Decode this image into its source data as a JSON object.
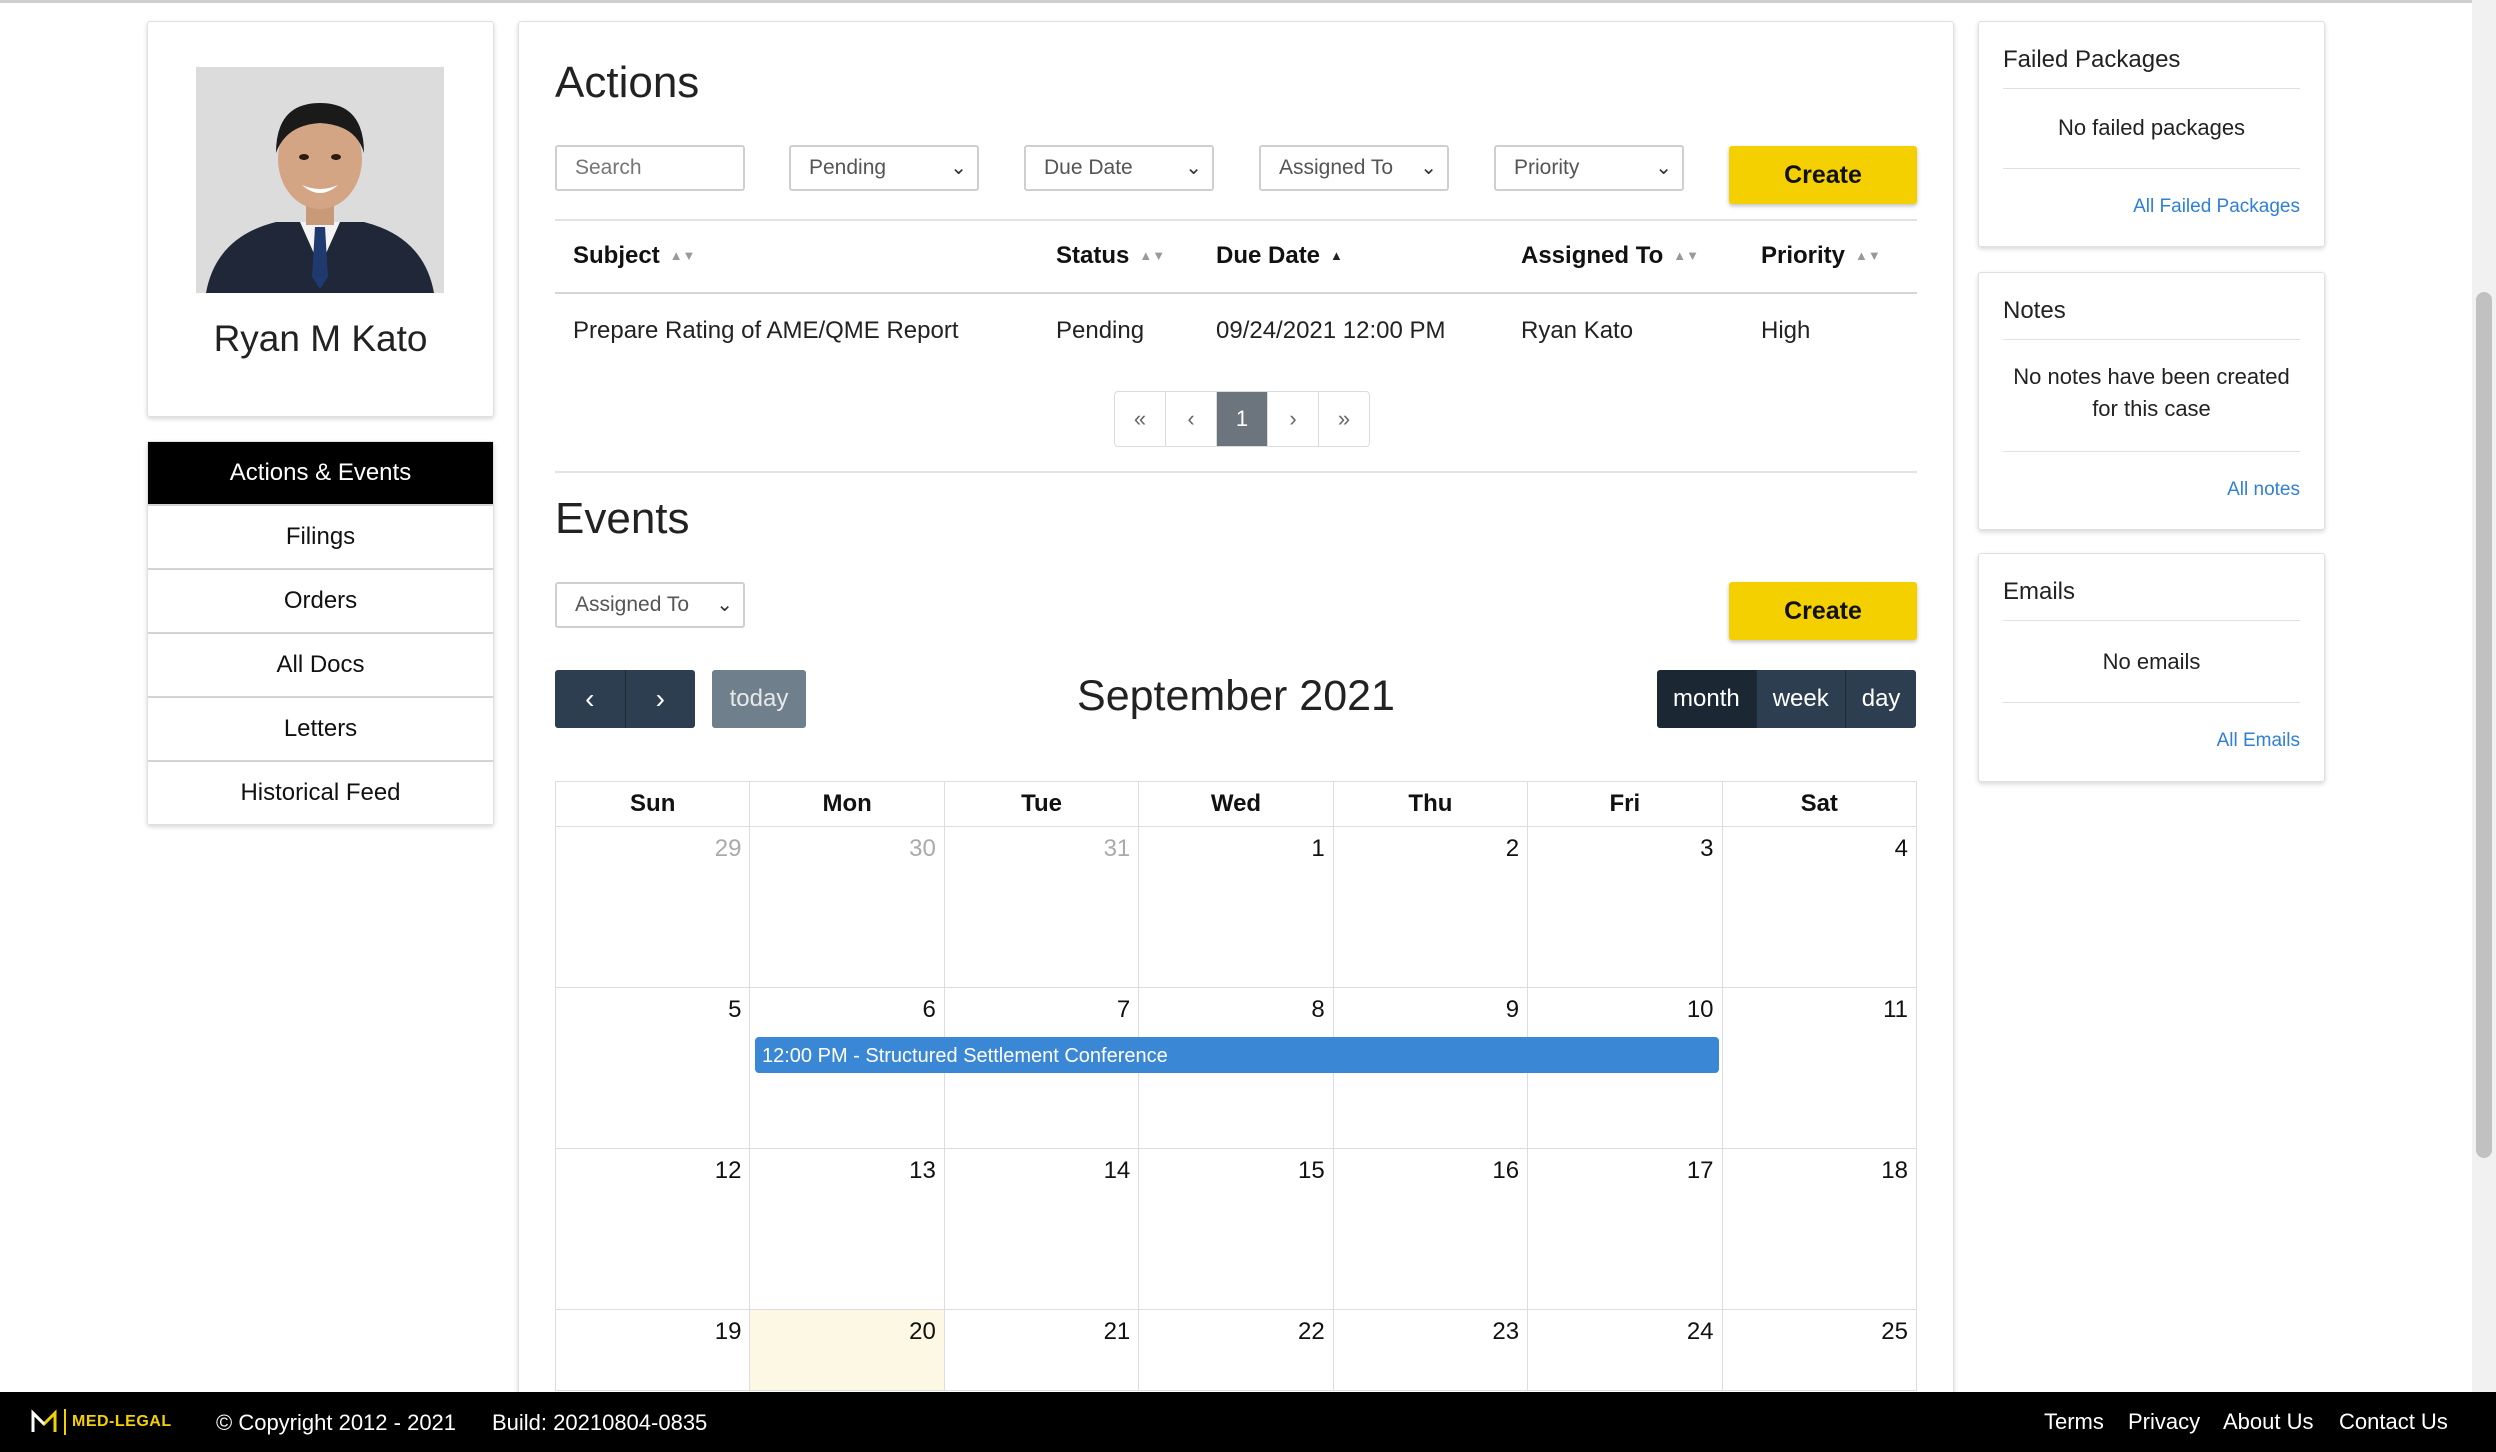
{
  "profile": {
    "name": "Ryan M Kato"
  },
  "nav": {
    "items": [
      {
        "label": "Actions & Events",
        "active": true
      },
      {
        "label": "Filings"
      },
      {
        "label": "Orders"
      },
      {
        "label": "All Docs"
      },
      {
        "label": "Letters"
      },
      {
        "label": "Historical Feed"
      }
    ]
  },
  "actions": {
    "title": "Actions",
    "search_placeholder": "Search",
    "filters": {
      "status": "Pending",
      "due_date": "Due Date",
      "assigned_to": "Assigned To",
      "priority": "Priority"
    },
    "create_label": "Create",
    "columns": {
      "subject": "Subject",
      "status": "Status",
      "due_date": "Due Date",
      "assigned_to": "Assigned To",
      "priority": "Priority"
    },
    "rows": [
      {
        "subject": "Prepare Rating of AME/QME Report",
        "status": "Pending",
        "due_date": "09/24/2021 12:00 PM",
        "assigned_to": "Ryan Kato",
        "priority": "High"
      }
    ],
    "pagination": {
      "first": "«",
      "prev": "‹",
      "current": "1",
      "next": "›",
      "last": "»"
    }
  },
  "events": {
    "title": "Events",
    "assigned_filter": "Assigned To",
    "create_label": "Create",
    "today_label": "today",
    "month_title": "September 2021",
    "views": {
      "month": "month",
      "week": "week",
      "day": "day"
    },
    "weekdays": [
      "Sun",
      "Mon",
      "Tue",
      "Wed",
      "Thu",
      "Fri",
      "Sat"
    ],
    "weeks": [
      [
        "29",
        "30",
        "31",
        "1",
        "2",
        "3",
        "4"
      ],
      [
        "5",
        "6",
        "7",
        "8",
        "9",
        "10",
        "11"
      ],
      [
        "12",
        "13",
        "14",
        "15",
        "16",
        "17",
        "18"
      ],
      [
        "19",
        "20",
        "21",
        "22",
        "23",
        "24",
        "25"
      ]
    ],
    "calendar_event": "12:00 PM - Structured Settlement Conference"
  },
  "failed_packages": {
    "title": "Failed Packages",
    "message": "No failed packages",
    "link": "All Failed Packages"
  },
  "notes": {
    "title": "Notes",
    "message": "No notes have been created for this case",
    "link": "All notes"
  },
  "emails": {
    "title": "Emails",
    "message": "No emails",
    "link": "All Emails"
  },
  "footer": {
    "brand": "MED-LEGAL",
    "copyright": "© Copyright 2012 - 2021",
    "build": "Build: 20210804-0835",
    "links": {
      "terms": "Terms",
      "privacy": "Privacy",
      "about": "About Us",
      "contact": "Contact Us"
    }
  },
  "colors": {
    "accent": "#f5d000",
    "dark_button": "#2c3e50",
    "event": "#3a87d6",
    "today_cell": "#fcf8e3",
    "link": "#2f7fd8"
  }
}
